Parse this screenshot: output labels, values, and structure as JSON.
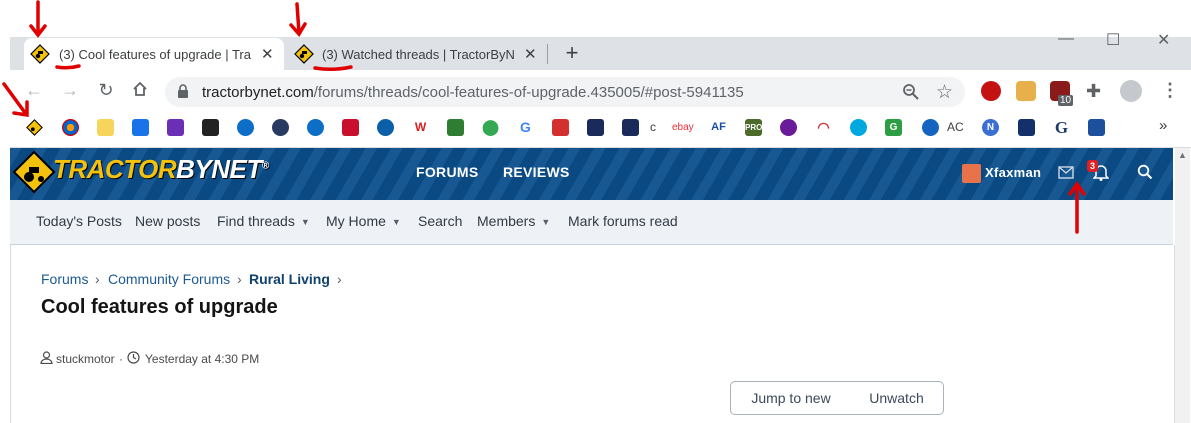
{
  "browser": {
    "tabs": [
      {
        "title": "(3) Cool features of upgrade | Tra",
        "active": true
      },
      {
        "title": "(3) Watched threads | TractorByN",
        "active": false
      }
    ],
    "new_tab_label": "+",
    "window_controls": {
      "minimize": "—",
      "maximize": "☐",
      "close": "✕"
    },
    "url": {
      "host": "tractorbynet.com",
      "path": "/forums/threads/cool-features-of-upgrade.435005/#post-5941135"
    },
    "extension_badge": "10",
    "bookmarks_text": {
      "ac": "AC",
      "c": "c",
      "ebay": "ebay"
    },
    "overflow_label": "»"
  },
  "site": {
    "logo": {
      "part1": "TRACTOR",
      "part2": "BYNET",
      "mark": "®"
    },
    "nav": {
      "forums": "FORUMS",
      "reviews": "REVIEWS"
    },
    "user": {
      "name": "Xfaxman",
      "notifications_badge": "3"
    },
    "subnav": [
      "Today's Posts",
      "New posts",
      "Find threads",
      "My Home",
      "Search",
      "Members",
      "Mark forums read"
    ],
    "breadcrumb": [
      "Forums",
      "Community Forums",
      "Rural Living"
    ],
    "thread": {
      "title": "Cool features of upgrade",
      "author": "stuckmotor",
      "time": "Yesterday at 4:30 PM"
    },
    "buttons": {
      "jump_to_new": "Jump to new",
      "unwatch": "Unwatch"
    }
  },
  "colors": {
    "header_blue": "#0b4f8c",
    "annotation_red": "#e00000",
    "link_blue": "#1d5a93",
    "tab_bg": "#dee1e6"
  }
}
